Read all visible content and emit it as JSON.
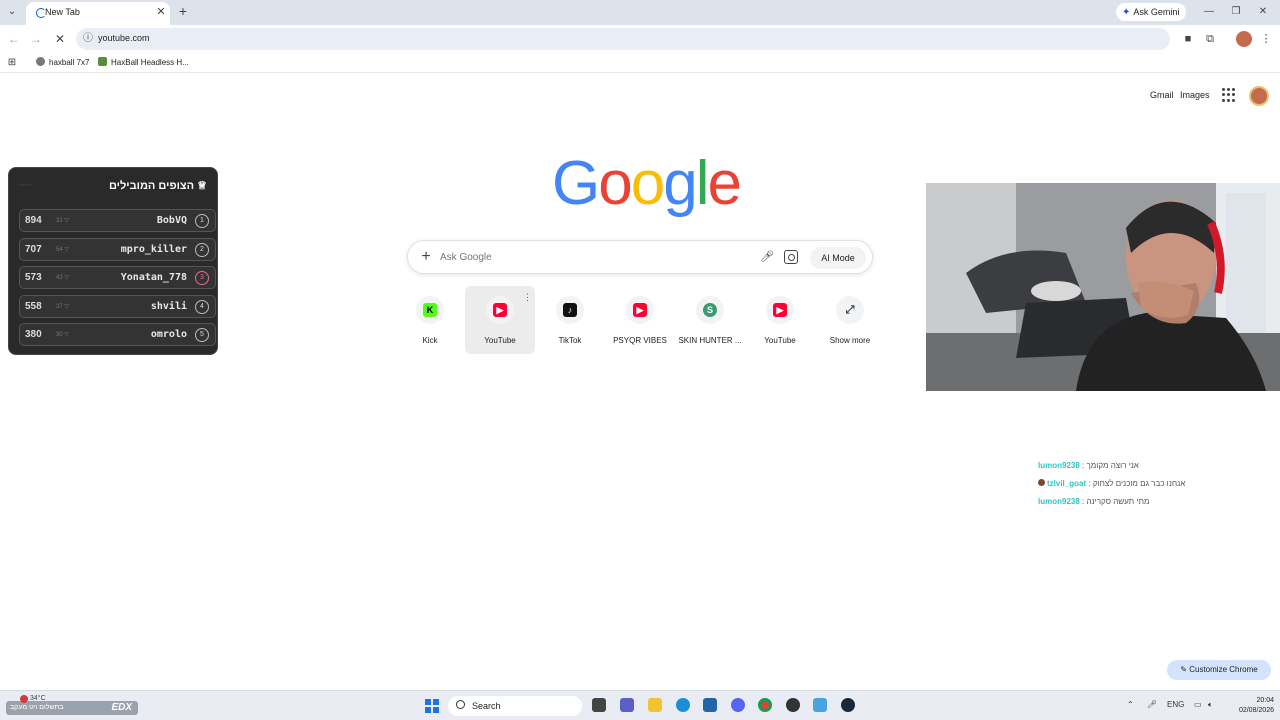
{
  "browser": {
    "tab_title": "New Tab",
    "ask_gemini": "Ask Gemini",
    "url": "youtube.com",
    "bookmarks": [
      {
        "label": "haxball 7x7"
      },
      {
        "label": "HaxBall Headless H..."
      }
    ]
  },
  "ntp": {
    "header_links": [
      "Gmail",
      "Images"
    ],
    "logo": [
      "G",
      "o",
      "o",
      "g",
      "l",
      "e"
    ],
    "search_placeholder": "Ask Google",
    "ai_mode": "AI Mode",
    "shortcuts": [
      {
        "label": "Kick",
        "icon": "kick-icon",
        "color": "#53fc18",
        "glyph": "K"
      },
      {
        "label": "YouTube",
        "icon": "youtube-icon",
        "color": "#ff0033",
        "glyph": "▶"
      },
      {
        "label": "TikTok",
        "icon": "tiktok-icon",
        "color": "#111111",
        "glyph": "♪"
      },
      {
        "label": "PSYQR VIBES",
        "icon": "youtube-icon",
        "color": "#ff0033",
        "glyph": "▶"
      },
      {
        "label": "SKIN HUNTER ...",
        "icon": "s-icon",
        "color": "#3a9b72",
        "glyph": "S"
      },
      {
        "label": "YouTube",
        "icon": "youtube-icon",
        "color": "#ff0033",
        "glyph": "▶"
      },
      {
        "label": "Show more",
        "icon": "expand-icon",
        "color": "#f1f3f4",
        "glyph": "⤢"
      }
    ],
    "customize_chrome": "Customize Chrome"
  },
  "leaderboard": {
    "title": "הצופים המובילים",
    "rows": [
      {
        "score": "894",
        "small": "32 ▽",
        "name": "BobVQ",
        "rank": "1"
      },
      {
        "score": "707",
        "small": "54 ▽",
        "name": "mpro_killer",
        "rank": "2"
      },
      {
        "score": "573",
        "small": "43 ▽",
        "name": "Yonatan_778",
        "rank": "3"
      },
      {
        "score": "558",
        "small": "37 ▽",
        "name": "shvili",
        "rank": "4"
      },
      {
        "score": "380",
        "small": "30 ▽",
        "name": "omrolo",
        "rank": "5"
      }
    ]
  },
  "chat": [
    {
      "user": "lumon9238",
      "message": ": אני רוצה מקומך"
    },
    {
      "user": "tzlvil_goat",
      "message": ": אנחנו כבר גם מוכנים לצחוק"
    },
    {
      "user": "lumon9238",
      "message": ": מתי תעשה סקרינה"
    }
  ],
  "taskbar": {
    "weather": "34°C",
    "ticker": "בתשלום ויט מעקב",
    "ticker_brand": "EDX",
    "search": "Search",
    "lang": "ENG",
    "time": "20:04",
    "date": "02/08/2026"
  }
}
